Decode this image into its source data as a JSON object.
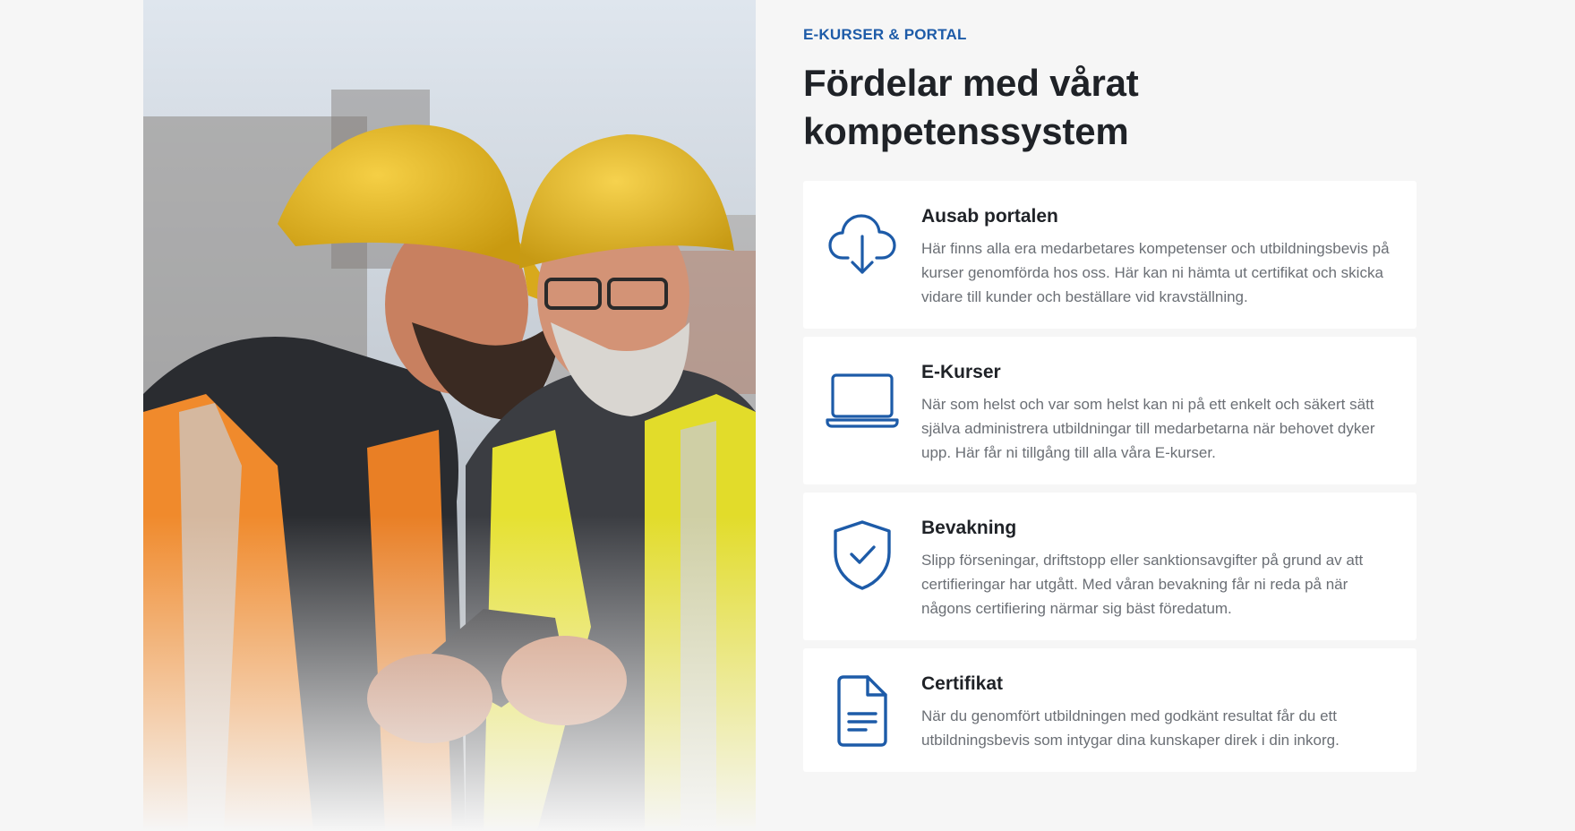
{
  "section": {
    "eyebrow": "E-KURSER & PORTAL",
    "heading": "Fördelar med vårat kompetenssystem"
  },
  "features": [
    {
      "icon": "cloud-download-icon",
      "title": "Ausab portalen",
      "description": "Här finns alla era medarbetares kompetenser och utbildningsbevis på kurser genomförda hos oss. Här kan ni hämta ut certifikat och skicka vidare till kunder och beställare vid kravställning."
    },
    {
      "icon": "laptop-icon",
      "title": "E-Kurser",
      "description": "När som helst och var som helst kan ni på ett enkelt och säkert sätt själva administrera utbildningar till medarbetarna när behovet dyker upp. Här får ni tillgång till alla våra E-kurser."
    },
    {
      "icon": "shield-check-icon",
      "title": "Bevakning",
      "description": "Slipp förseningar, driftstopp eller sanktionsavgifter på grund av att certifieringar har utgått. Med våran bevakning får ni reda på när någons certifiering närmar sig bäst föredatum."
    },
    {
      "icon": "document-icon",
      "title": "Certifikat",
      "description": "När du genomfört utbildningen med godkänt resultat får du ett utbildningsbevis som intygar dina kunskaper direk i din inkorg."
    }
  ],
  "colors": {
    "accent": "#1d5ba8",
    "background": "#f6f6f6",
    "card": "#ffffff",
    "heading": "#1f2227",
    "body_text": "#6b6f75"
  }
}
